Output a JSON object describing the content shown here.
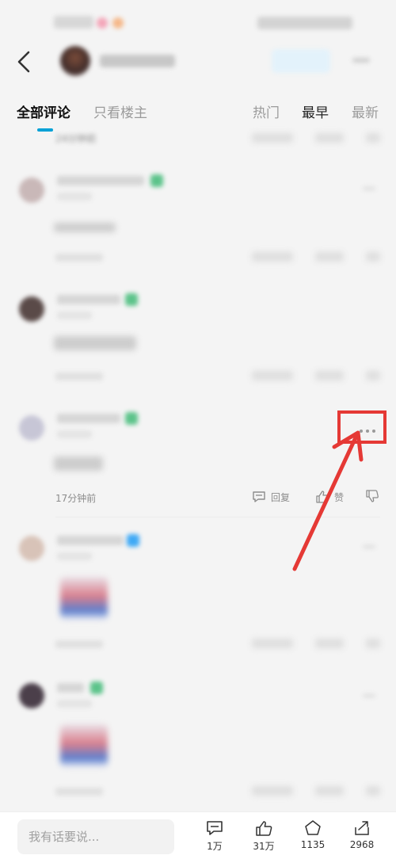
{
  "tabs": {
    "all_comments": "全部评论",
    "op_only": "只看楼主"
  },
  "sort": {
    "hot": "热门",
    "earliest": "最早",
    "newest": "最新"
  },
  "top_comment": {
    "time": "24分钟前"
  },
  "highlight_comment": {
    "time": "17分钟前",
    "reply_label": "回复",
    "like_label": "赞"
  },
  "bottom": {
    "input_placeholder": "我有话要说...",
    "comment_count": "1万",
    "like_count": "31万",
    "coin_count": "1135",
    "share_count": "2968"
  },
  "colors": {
    "accent": "#00a1d6",
    "highlight_red": "#e53935",
    "level_green": "#5cc38a",
    "verified_blue": "#3fa9f5"
  },
  "icons": {
    "back": "chevron-left-icon",
    "more": "more-dots-icon",
    "reply": "reply-icon",
    "like": "thumbs-up-icon",
    "dislike": "thumbs-down-icon",
    "comment": "comment-icon",
    "coin": "coin-icon",
    "share": "share-icon",
    "arrow": "red-arrow-annotation"
  }
}
